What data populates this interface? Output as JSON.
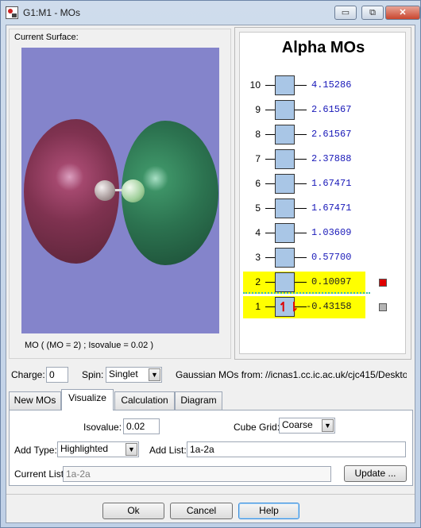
{
  "window": {
    "title": "G1:M1 - MOs",
    "minimize": "▭",
    "restore": "⧉",
    "close": "✕"
  },
  "surface": {
    "label": "Current Surface:",
    "caption": "MO ( (MO = 2) ; Isovalue = 0.02 )",
    "colors": {
      "background": "#8484cb",
      "positive_lobe": "#7f3250",
      "negative_lobe": "#2c7350"
    }
  },
  "mo_panel": {
    "title": "Alpha MOs",
    "orbitals": [
      {
        "index": "10",
        "energy": "4.15286",
        "occupancy": "",
        "highlighted": false
      },
      {
        "index": "9",
        "energy": "2.61567",
        "occupancy": "",
        "highlighted": false
      },
      {
        "index": "8",
        "energy": "2.61567",
        "occupancy": "",
        "highlighted": false
      },
      {
        "index": "7",
        "energy": "2.37888",
        "occupancy": "",
        "highlighted": false
      },
      {
        "index": "6",
        "energy": "1.67471",
        "occupancy": "",
        "highlighted": false
      },
      {
        "index": "5",
        "energy": "1.67471",
        "occupancy": "",
        "highlighted": false
      },
      {
        "index": "4",
        "energy": "1.03609",
        "occupancy": "",
        "highlighted": false
      },
      {
        "index": "3",
        "energy": "0.57700",
        "occupancy": "",
        "highlighted": false
      },
      {
        "index": "2",
        "energy": "0.10097",
        "occupancy": "",
        "highlighted": true,
        "marker_color": "#e00000"
      },
      {
        "index": "1",
        "energy": "-0.43158",
        "occupancy": "↿⇂",
        "highlighted": true,
        "marker_color": "#b4b4b4"
      }
    ]
  },
  "options": {
    "charge_label": "Charge:",
    "charge_value": "0",
    "spin_label": "Spin:",
    "spin_value": "Singlet",
    "source_label": "Gaussian MOs from:",
    "source_value": "//icnas1.cc.ic.ac.uk/cjc415/Deskto"
  },
  "tabs": [
    {
      "label": "New MOs",
      "active": false
    },
    {
      "label": "Visualize",
      "active": true
    },
    {
      "label": "Calculation",
      "active": false
    },
    {
      "label": "Diagram",
      "active": false
    }
  ],
  "visualize": {
    "isovalue_label": "Isovalue:",
    "isovalue_value": "0.02",
    "cube_grid_label": "Cube Grid:",
    "cube_grid_value": "Coarse",
    "add_type_label": "Add Type:",
    "add_type_value": "Highlighted",
    "add_list_label": "Add List:",
    "add_list_value": "1a-2a",
    "current_list_label": "Current List:",
    "current_list_value": "1a-2a",
    "update_button": "Update ..."
  },
  "footer": {
    "ok": "Ok",
    "cancel": "Cancel",
    "help": "Help"
  }
}
